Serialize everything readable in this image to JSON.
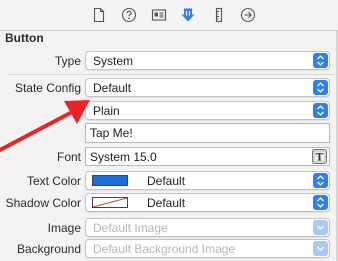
{
  "toolbar": {
    "icons": [
      "file-inspector-icon",
      "quick-help-icon",
      "identity-inspector-icon",
      "attributes-inspector-icon",
      "size-inspector-icon",
      "connections-inspector-icon"
    ],
    "selected": "attributes-inspector-icon"
  },
  "section": {
    "title": "Button"
  },
  "rows": {
    "type": {
      "label": "Type",
      "value": "System"
    },
    "state_config": {
      "label": "State Config",
      "value": "Default"
    },
    "title_style": {
      "value": "Plain"
    },
    "title_text": {
      "value": "Tap Me!"
    },
    "font": {
      "label": "Font",
      "value": "System 15.0",
      "button_glyph": "T"
    },
    "text_color": {
      "label": "Text Color",
      "value": "Default",
      "swatch": "#1a6fd8"
    },
    "shadow_color": {
      "label": "Shadow Color",
      "value": "Default",
      "swatch": "none"
    },
    "image": {
      "label": "Image",
      "placeholder": "Default Image"
    },
    "background": {
      "label": "Background",
      "placeholder": "Default Background Image"
    }
  },
  "colors": {
    "accent": "#2f7ff0",
    "annotation_arrow": "#e8232a"
  }
}
